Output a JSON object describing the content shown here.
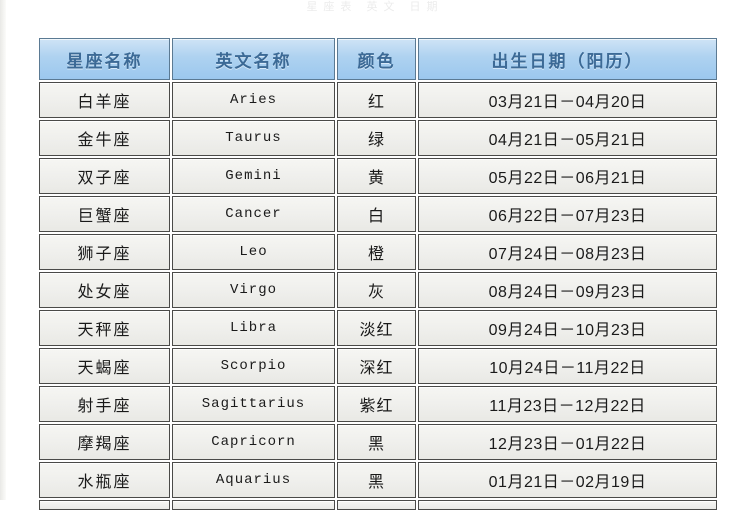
{
  "page": {
    "clipped_top_text": "星座表 英文 日期",
    "accent_header_color": "#aed2f0",
    "header_text_color": "#3c6a96",
    "cell_bg_color": "#efefec",
    "border_color": "#4a4a48"
  },
  "table": {
    "columns": [
      {
        "key": "name",
        "label": "星座名称"
      },
      {
        "key": "en",
        "label": "英文名称"
      },
      {
        "key": "color",
        "label": "颜色"
      },
      {
        "key": "date",
        "label": "出生日期（阳历）"
      }
    ],
    "rows": [
      {
        "name": "白羊座",
        "en": "Aries",
        "color": "红",
        "date": "03月21日－04月20日"
      },
      {
        "name": "金牛座",
        "en": "Taurus",
        "color": "绿",
        "date": "04月21日－05月21日"
      },
      {
        "name": "双子座",
        "en": "Gemini",
        "color": "黄",
        "date": "05月22日－06月21日"
      },
      {
        "name": "巨蟹座",
        "en": "Cancer",
        "color": "白",
        "date": "06月22日－07月23日"
      },
      {
        "name": "狮子座",
        "en": "Leo",
        "color": "橙",
        "date": "07月24日－08月23日"
      },
      {
        "name": "处女座",
        "en": "Virgo",
        "color": "灰",
        "date": "08月24日－09月23日"
      },
      {
        "name": "天秤座",
        "en": "Libra",
        "color": "淡红",
        "date": "09月24日－10月23日"
      },
      {
        "name": "天蝎座",
        "en": "Scorpio",
        "color": "深红",
        "date": "10月24日－11月22日"
      },
      {
        "name": "射手座",
        "en": "Sagittarius",
        "color": "紫红",
        "date": "11月23日－12月22日"
      },
      {
        "name": "摩羯座",
        "en": "Capricorn",
        "color": "黑",
        "date": "12月23日－01月22日"
      },
      {
        "name": "水瓶座",
        "en": "Aquarius",
        "color": "黑",
        "date": "01月21日－02月19日"
      }
    ]
  }
}
